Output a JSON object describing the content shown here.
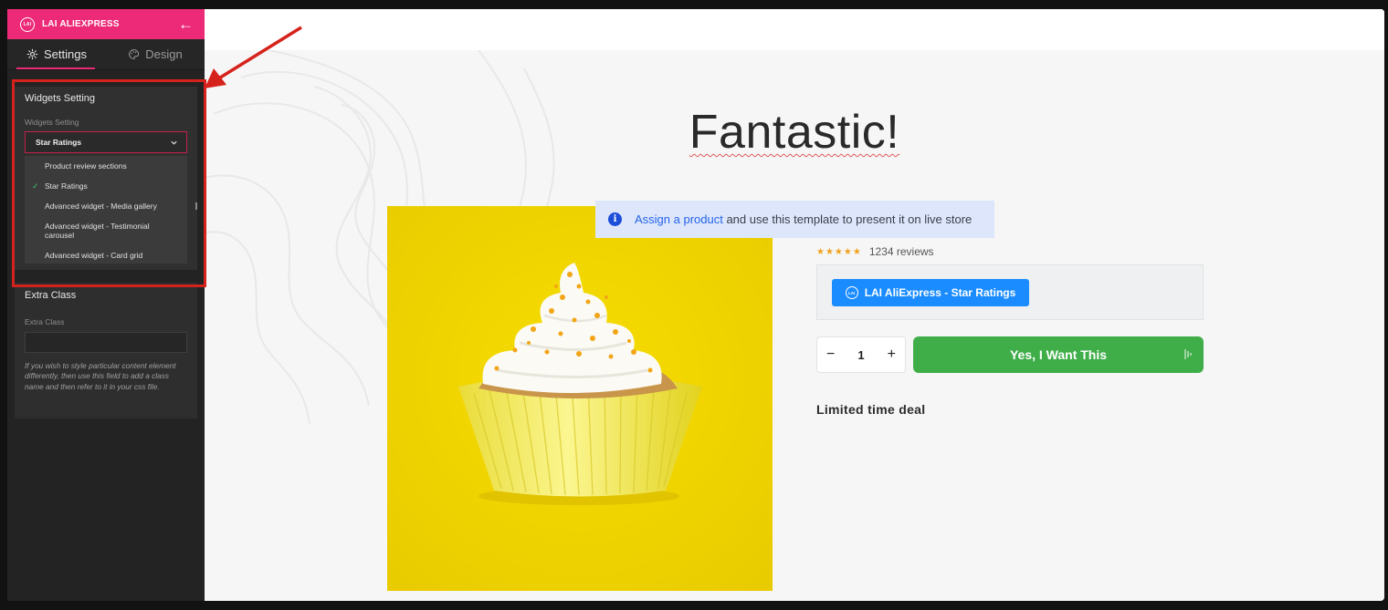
{
  "sidebar": {
    "brand": "LAI ALIEXPRESS",
    "brand_logo_text": "LAI",
    "tabs": [
      {
        "label": "Settings",
        "active": true,
        "icon": "gear-icon"
      },
      {
        "label": "Design",
        "active": false,
        "icon": "palette-icon"
      }
    ],
    "widgets_panel": {
      "title": "Widgets Setting",
      "field_label": "Widgets Setting",
      "selected": "Star Ratings",
      "options": [
        {
          "label": "Product review sections",
          "checked": false
        },
        {
          "label": "Star Ratings",
          "checked": true
        },
        {
          "label": "Advanced widget - Media gallery",
          "checked": false
        },
        {
          "label": "Advanced widget - Testimonial carousel",
          "checked": false
        },
        {
          "label": "Advanced widget - Card grid",
          "checked": false
        }
      ]
    },
    "extra_panel": {
      "title": "Extra Class",
      "field_label": "Extra Class",
      "value": "",
      "help": "If you wish to style particular content element differently, then use this field to add a class name and then refer to it in your css file."
    }
  },
  "main": {
    "title": "Fantastic!",
    "info": {
      "link": "Assign a product",
      "text": " and use this template to present it on live store"
    },
    "rating": {
      "stars": "★★★★★",
      "reviews": "1234 reviews"
    },
    "widget_button": "LAI AliExpress - Star Ratings",
    "quantity": {
      "minus": "−",
      "value": "1",
      "plus": "+"
    },
    "buy_button": "Yes, I Want This",
    "deal": "Limited time deal"
  },
  "colors": {
    "brand": "#ec2a78",
    "highlight": "#d6221c",
    "buy": "#3fae49",
    "widget_button": "#1a8cff",
    "product_bg": "#efd400"
  }
}
